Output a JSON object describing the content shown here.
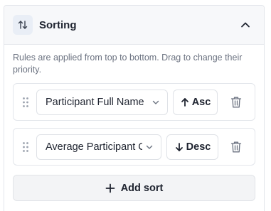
{
  "header": {
    "title": "Sorting",
    "icon": "sort-arrows-icon",
    "collapse_icon": "chevron-up-icon"
  },
  "hint": "Rules are applied from top to bottom. Drag to change their priority.",
  "rules": [
    {
      "field": "Participant Full Name",
      "direction": "Asc",
      "direction_icon": "arrow-up-icon"
    },
    {
      "field": "Average Participant C",
      "direction": "Desc",
      "direction_icon": "arrow-down-icon"
    }
  ],
  "add_button": {
    "label": "Add sort",
    "icon": "plus-icon"
  },
  "colors": {
    "header_bg": "#f7f8fa",
    "icon_bg": "#e9eef6",
    "border": "#e3e6eb",
    "text": "#1f2430",
    "muted": "#6b7280",
    "add_bg": "#f3f4f6"
  }
}
